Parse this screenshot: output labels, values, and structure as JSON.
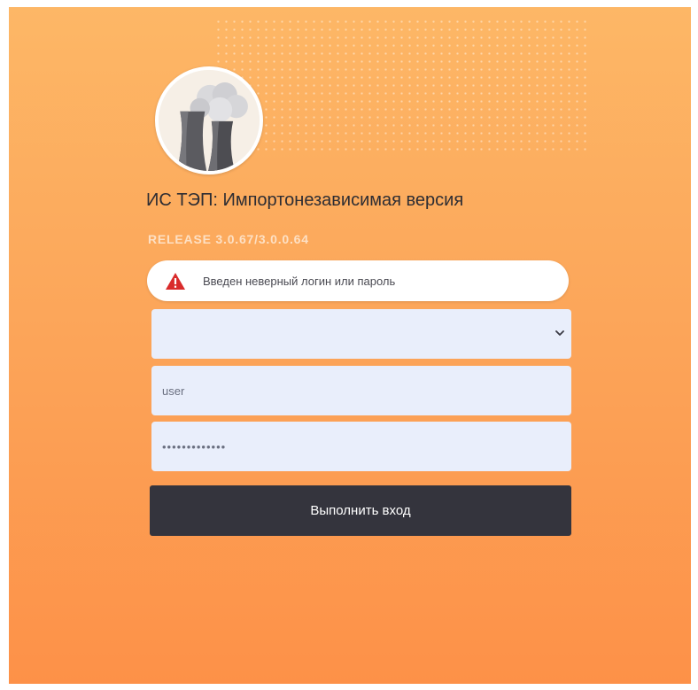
{
  "app": {
    "title": "ИС ТЭП: Импортонезависимая версия",
    "release": "RELEASE 3.0.67/3.0.0.64"
  },
  "alert": {
    "message": "Введен неверный логин или пароль",
    "icon": "warning-icon",
    "icon_color": "#d92b2b"
  },
  "form": {
    "select_value": "",
    "username_value": "user",
    "password_value": "•••••••••••••",
    "submit_label": "Выполнить вход"
  },
  "colors": {
    "background_top": "#fdb766",
    "background_bottom": "#fd9148",
    "field_background": "#e9eefb",
    "button_background": "#34343d"
  }
}
